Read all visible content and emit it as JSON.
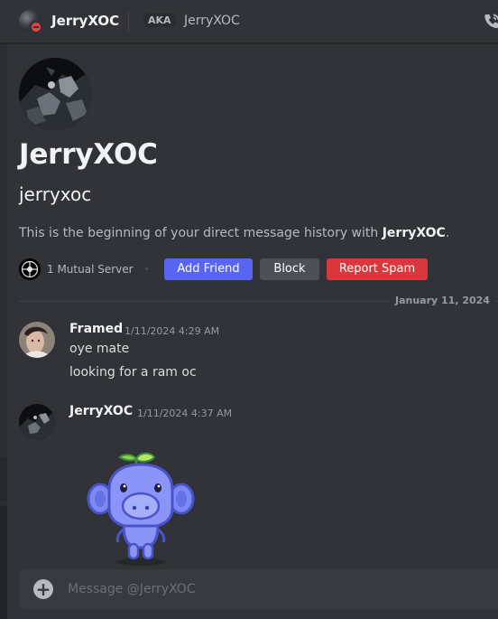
{
  "header": {
    "title": "JerryXOC",
    "aka_label": "AKA",
    "aka_name": "JerryXOC",
    "icons": {
      "avatar": "user-avatar",
      "status": "do-not-disturb-status",
      "call": "phone-call-icon"
    }
  },
  "intro": {
    "display_name": "JerryXOC",
    "username": "jerryxoc",
    "history_prefix": "This is the beginning of your direct message history with ",
    "history_name": "JerryXOC",
    "history_suffix": ".",
    "mutual_servers": "1 Mutual Server",
    "buttons": {
      "add_friend": "Add Friend",
      "block": "Block",
      "report_spam": "Report Spam"
    }
  },
  "date_divider": "January 11, 2024",
  "messages": [
    {
      "author": "Framed",
      "timestamp": "1/11/2024 4:29 AM",
      "lines": [
        "oye mate",
        "looking for a ram oc"
      ]
    },
    {
      "author": "JerryXOC",
      "timestamp": "1/11/2024 4:37 AM",
      "lines": [],
      "sticker": "wumpus-sprout-sticker"
    }
  ],
  "composer": {
    "placeholder": "Message @JerryXOC",
    "value": ""
  },
  "colors": {
    "background": "#313338",
    "add_friend": "#5865f2",
    "block": "#4e5058",
    "report_spam": "#da373c",
    "status_dnd": "#f23f43"
  }
}
